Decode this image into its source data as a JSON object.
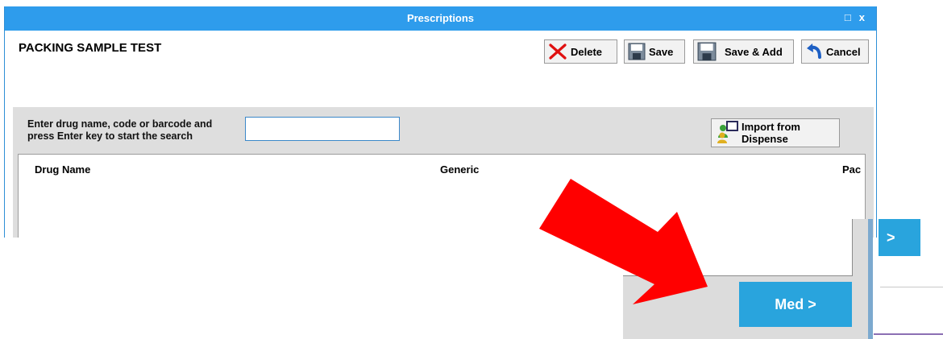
{
  "window": {
    "title": "Prescriptions",
    "maximize_glyph": "□",
    "close_glyph": "x"
  },
  "form": {
    "heading": "PACKING SAMPLE TEST"
  },
  "toolbar": {
    "delete_label": "Delete",
    "save_label": "Save",
    "save_add_label": "Save & Add",
    "cancel_label": "Cancel"
  },
  "search": {
    "hint_line1": "Enter drug name, code or barcode and",
    "hint_line2": "press Enter key to start the search",
    "value": ""
  },
  "import_button": {
    "label": "Import from Dispense"
  },
  "table": {
    "columns": [
      "Drug Name",
      "Generic",
      "Pac"
    ],
    "rows": []
  },
  "background_window": {
    "button_label": ">"
  },
  "inset": {
    "button_label": "Med >"
  },
  "colors": {
    "titlebar": "#2e9cec",
    "accent_button": "#29a4dd",
    "arrow": "#ff0000",
    "panel": "#dedede"
  },
  "icons": [
    "delete-x-icon",
    "save-disk-icon",
    "save-add-disk-icon",
    "cancel-undo-icon",
    "import-people-icon",
    "red-arrow-annotation"
  ]
}
